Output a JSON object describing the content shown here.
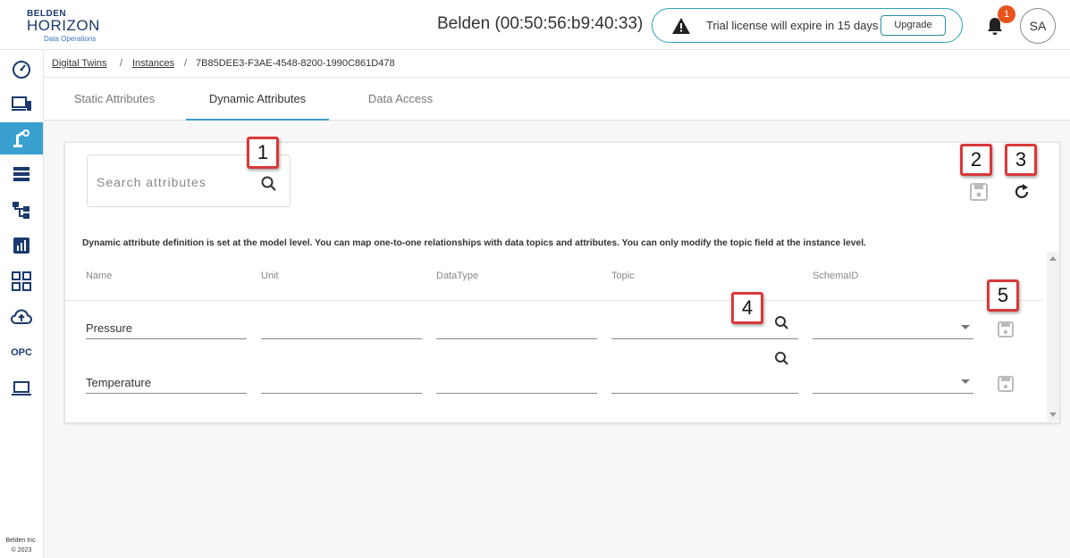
{
  "header": {
    "logo": {
      "line1": "BELDEN",
      "line2": "HORIZON",
      "line3": "Data Operations"
    },
    "device_title": "Belden (00:50:56:b9:40:33)",
    "license_message": "Trial license will expire in 15 days",
    "upgrade_label": "Upgrade",
    "notification_count": "1",
    "user_initials": "SA"
  },
  "sidebar": {
    "items": [
      "dashboard-icon",
      "devices-icon",
      "digital-twins-icon",
      "storage-icon",
      "hierarchy-icon",
      "reports-icon",
      "apps-icon",
      "upload-cloud-icon",
      "opc-label",
      "laptop-icon"
    ],
    "opc_label": "OPC",
    "copyright_line1": "Belden Inc.",
    "copyright_line2": "© 2023",
    "accent_color": "#3aa0d0"
  },
  "breadcrumb": {
    "items": [
      "Digital Twins",
      "Instances",
      "7B85DEE3-F3AE-4548-8200-1990C861D478"
    ],
    "separator": "/"
  },
  "tabs": [
    {
      "label": "Static Attributes",
      "active": false
    },
    {
      "label": "Dynamic Attributes",
      "active": true
    },
    {
      "label": "Data Access",
      "active": false
    }
  ],
  "card": {
    "search_placeholder": "Search attributes",
    "description": "Dynamic attribute definition is set at the model level. You can map one-to-one relationships with data topics and attributes. You can only modify the topic field at the instance level.",
    "columns": [
      "Name",
      "Unit",
      "DataType",
      "Topic",
      "SchemaID"
    ],
    "rows": [
      {
        "name": "Pressure",
        "unit": "",
        "datatype": "",
        "topic": "",
        "schemaid": ""
      },
      {
        "name": "Temperature",
        "unit": "",
        "datatype": "",
        "topic": "",
        "schemaid": ""
      }
    ]
  },
  "callouts": [
    "1",
    "2",
    "3",
    "4",
    "5"
  ]
}
